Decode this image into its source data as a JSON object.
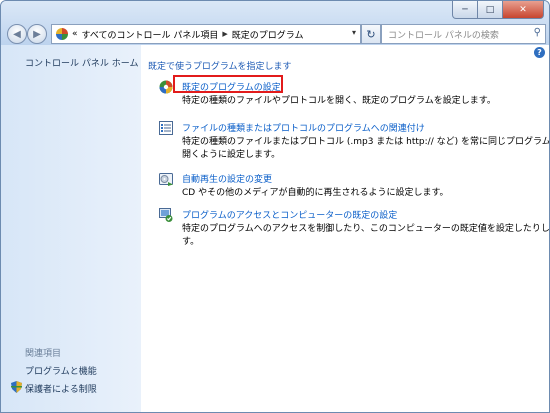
{
  "titlebar": {
    "minimize": "─",
    "maximize": "□",
    "close": "✕"
  },
  "address": {
    "overflow": "«",
    "crumbs": [
      "すべてのコントロール パネル項目",
      "既定のプログラム"
    ],
    "separator": "▶",
    "dropdown": "▾"
  },
  "search": {
    "placeholder": "コントロール パネルの検索"
  },
  "sidebar": {
    "home": "コントロール パネル ホーム",
    "related_heading": "関連項目",
    "related": [
      "プログラムと機能",
      "保護者による制限"
    ]
  },
  "main": {
    "help": "?",
    "heading": "既定で使うプログラムを指定します",
    "items": [
      {
        "title": "既定のプログラムの設定",
        "desc": [
          "特定の種類のファイルやプロトコルを開く、既定のプログラムを設定します。"
        ],
        "icon": "default-programs-icon"
      },
      {
        "title": "ファイルの種類またはプロトコルのプログラムへの関連付け",
        "desc": [
          "特定の種類のファイルまたはプロトコル (.mp3 または http:// など) を常に同じプログラムで",
          "開くように設定します。"
        ],
        "icon": "file-association-icon"
      },
      {
        "title": "自動再生の設定の変更",
        "desc": [
          "CD やその他のメディアが自動的に再生されるように設定します。"
        ],
        "icon": "autoplay-icon"
      },
      {
        "title": "プログラムのアクセスとコンピューターの既定の設定",
        "desc": [
          "特定のプログラムへのアクセスを制御したり、このコンピューターの既定値を設定したりしま",
          "す。"
        ],
        "icon": "program-access-icon"
      }
    ]
  },
  "colors": {
    "highlight": "#e21b1b",
    "link": "#0b5fc9"
  }
}
